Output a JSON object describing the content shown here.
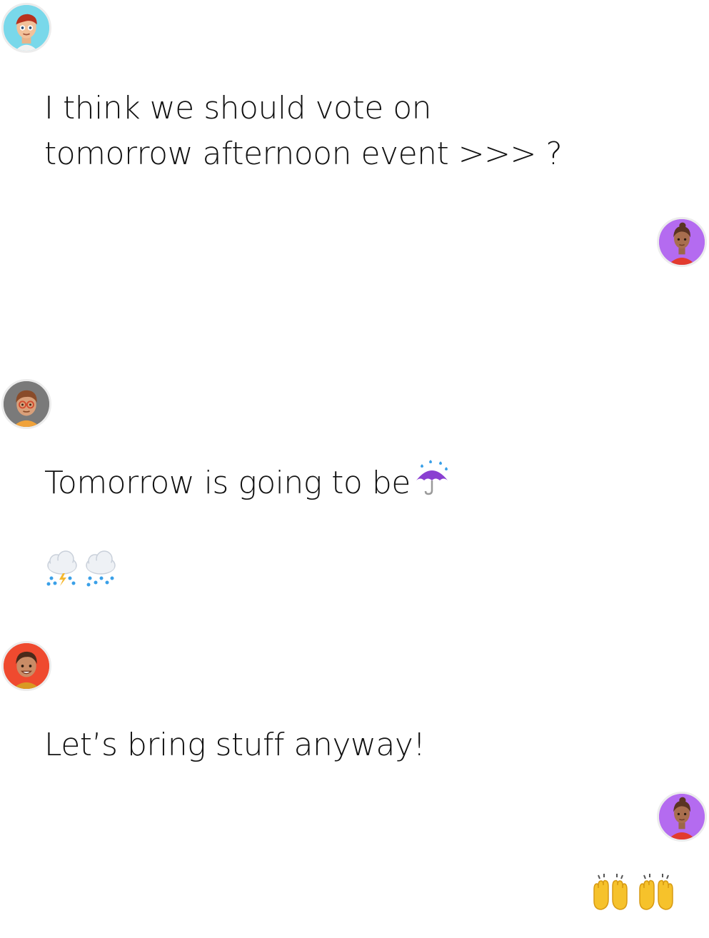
{
  "thread": {
    "messages": [
      {
        "sender": "user-1",
        "side": "left",
        "lines": [
          "I think we should vote on",
          "tomorrow afternoon event >>> ?"
        ]
      },
      {
        "sender": "user-2",
        "side": "right",
        "lines": []
      },
      {
        "sender": "user-3",
        "side": "left",
        "lines": [
          "Tomorrow is going to be"
        ],
        "inline_emoji": "umbrella-with-rain-icon"
      },
      {
        "sender": "user-3",
        "side": "left",
        "emojis": [
          "cloud-lightning-rain-icon",
          "cloud-rain-icon"
        ]
      },
      {
        "sender": "user-4",
        "side": "left",
        "lines": [
          "Let’s bring stuff anyway!"
        ]
      },
      {
        "sender": "user-2",
        "side": "right",
        "emojis": [
          "raising-hands-icon",
          "raising-hands-icon"
        ]
      }
    ]
  },
  "avatars": {
    "user-1": {
      "background": "#79d8ea"
    },
    "user-2": {
      "background": "#b46bf0"
    },
    "user-3": {
      "background": "#7a7a7a"
    },
    "user-4": {
      "background": "#ef4a2f"
    }
  }
}
